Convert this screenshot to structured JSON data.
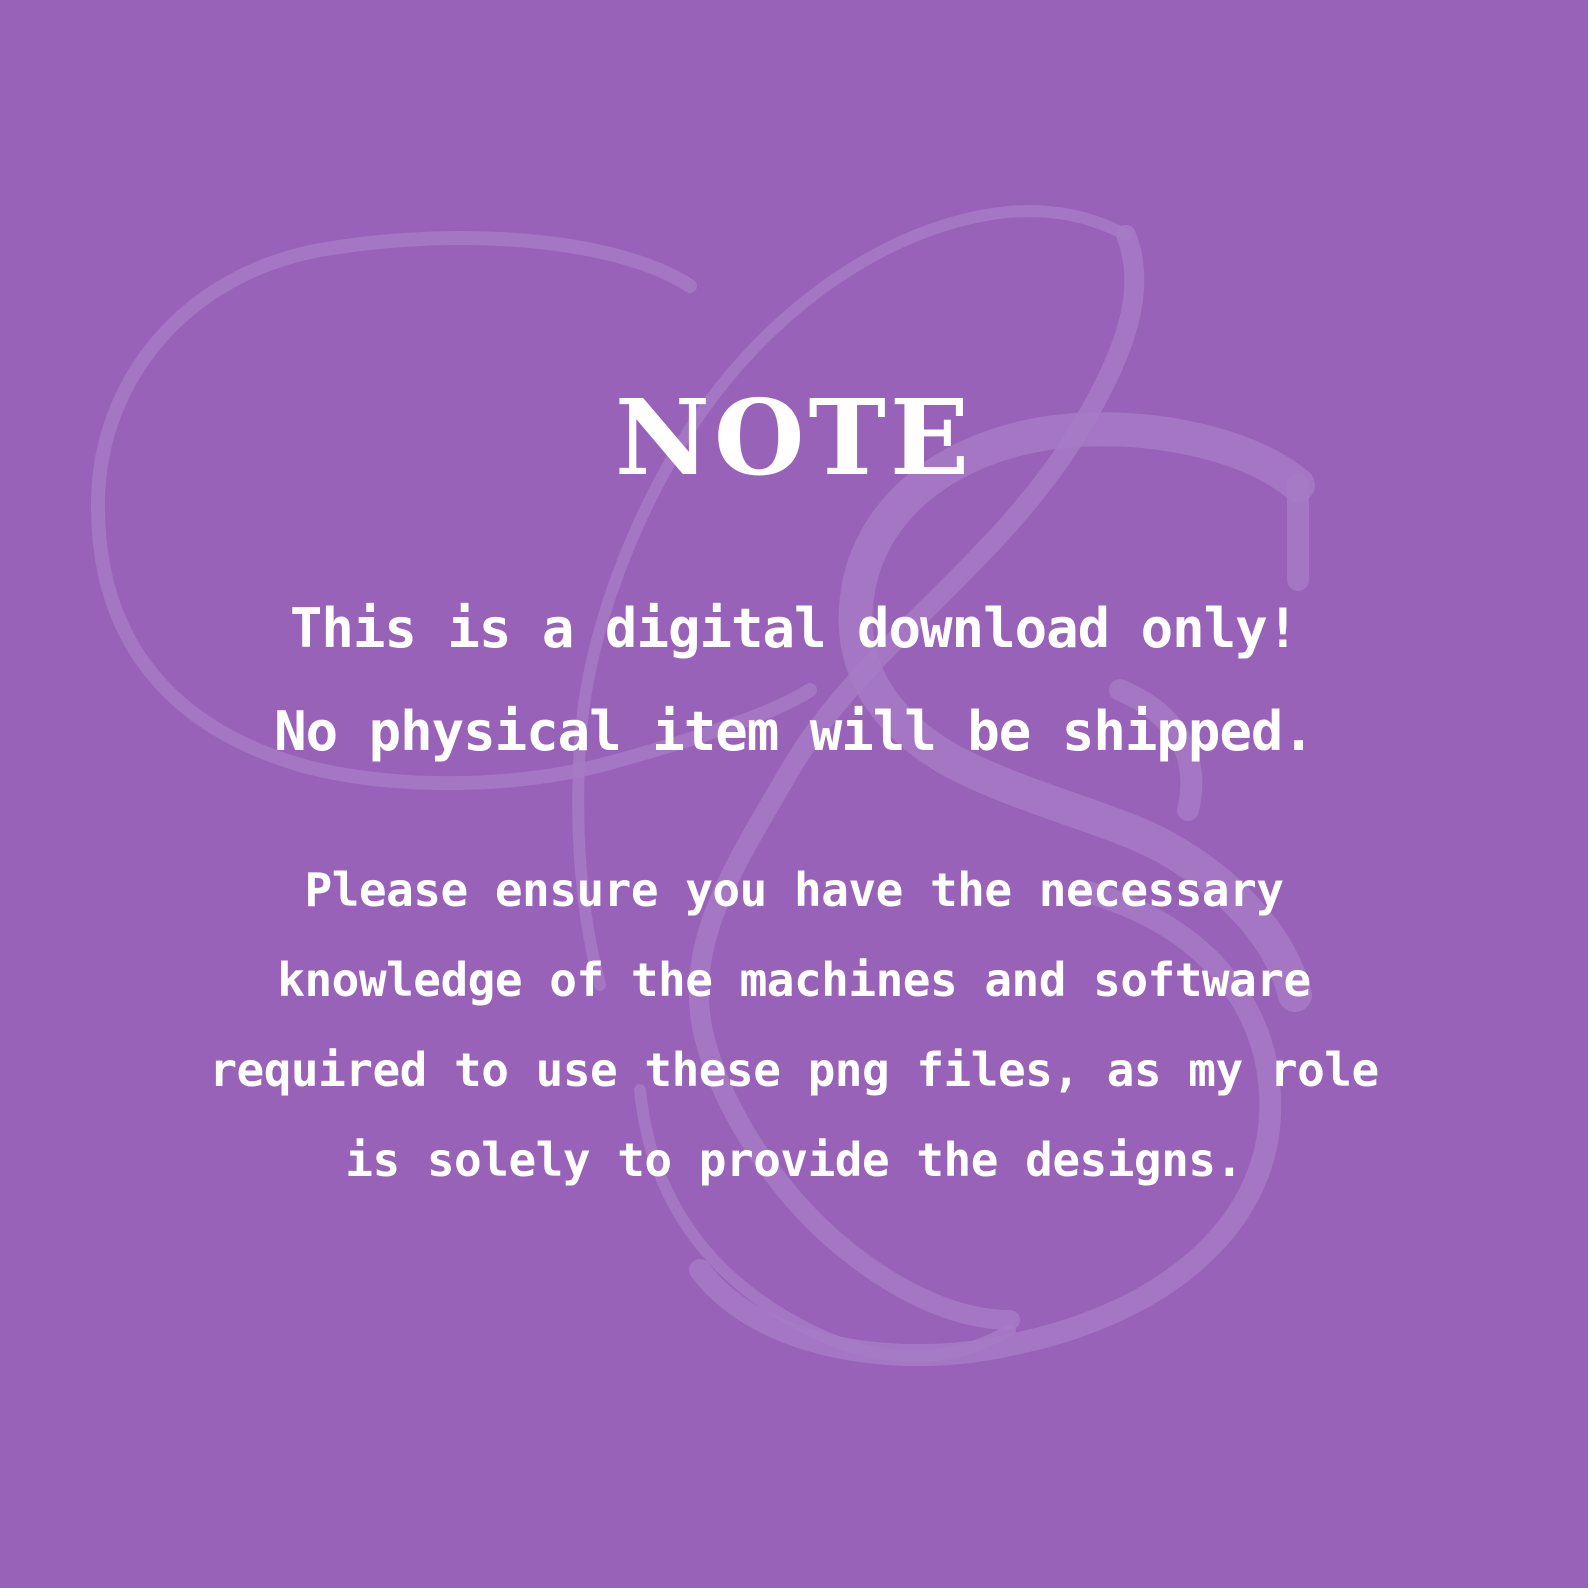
{
  "colors": {
    "background": "#9762B7",
    "monogram": "#A77BC6",
    "text": "#FFFFFF"
  },
  "monogram": {
    "type": "decorative-script-monogram"
  },
  "note": {
    "title": "NOTE",
    "lead_lines": [
      "This is a digital download only!",
      "No physical item will be shipped."
    ],
    "body_lines": [
      "Please ensure you have the necessary",
      "knowledge of the machines and software",
      "required to use these png files, as my role",
      "is solely to provide the designs."
    ]
  }
}
